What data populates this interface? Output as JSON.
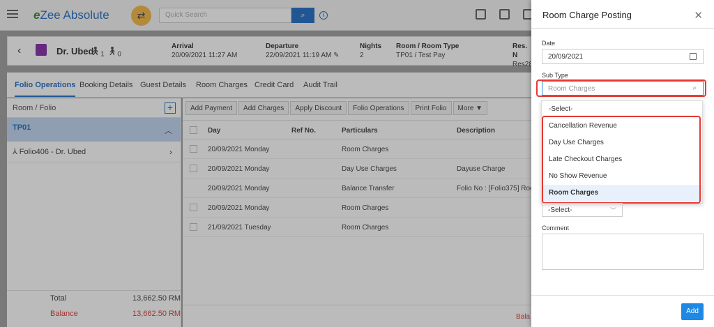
{
  "topbar": {
    "logo_e": "e",
    "logo_text": "Zee Absolute",
    "search_placeholder": "Quick Search",
    "search_icon": "search-icon",
    "info_icon": "info-icon"
  },
  "guest": {
    "back_icon": "back-arrow-icon",
    "name": "Dr. Ubed",
    "pax": "1 0",
    "arrival_label": "Arrival",
    "arrival_value": "20/09/2021 11:27 AM",
    "departure_label": "Departure",
    "departure_value": "22/09/2021 11:19 AM",
    "nights_label": "Nights",
    "nights_value": "2",
    "room_label": "Room / Room Type",
    "room_value": "TP01 / Test Pay",
    "res_label": "Res. N",
    "res_value": "Res28"
  },
  "tabs": [
    {
      "label": "Folio Operations"
    },
    {
      "label": "Booking Details"
    },
    {
      "label": "Guest Details"
    },
    {
      "label": "Room Charges"
    },
    {
      "label": "Credit Card"
    },
    {
      "label": "Audit Trail"
    }
  ],
  "left": {
    "header": "Room / Folio",
    "room": "TP01",
    "folio": "Folio406 - Dr. Ubed",
    "total_label": "Total",
    "total_value": "13,662.50 RM",
    "balance_label": "Balance",
    "balance_value": "13,662.50 RM"
  },
  "toolbar": {
    "add_payment": "Add Payment",
    "add_charges": "Add Charges",
    "apply_discount": "Apply Discount",
    "folio_operations": "Folio Operations",
    "print_folio": "Print Folio",
    "more": "More"
  },
  "table": {
    "headers": {
      "day": "Day",
      "ref": "Ref No.",
      "particulars": "Particulars",
      "description": "Description"
    },
    "rows": [
      {
        "day": "20/09/2021 Monday",
        "particulars": "Room Charges",
        "description": ""
      },
      {
        "day": "20/09/2021 Monday",
        "particulars": "Day Use Charges",
        "description": "Dayuse Charge"
      },
      {
        "day": "20/09/2021 Monday",
        "particulars": "Balance Transfer",
        "description": "Folio No : [Folio375] Roo"
      },
      {
        "day": "20/09/2021 Monday",
        "particulars": "Room Charges",
        "description": ""
      },
      {
        "day": "21/09/2021 Tuesday",
        "particulars": "Room Charges",
        "description": ""
      }
    ],
    "footer_bala": "Bala"
  },
  "drawer": {
    "title": "Room Charge Posting",
    "date_label": "Date",
    "date_value": "20/09/2021",
    "subtype_label": "Sub Type",
    "subtype_placeholder": "Room Charges",
    "options": [
      "-Select-",
      "Cancellation Revenue",
      "Day Use Charges",
      "Late Checkout Charges",
      "No Show Revenue",
      "Room Charges"
    ],
    "second_select": "-Select-",
    "comment_label": "Comment",
    "add_label": "Add"
  },
  "colors": {
    "accent": "#1565c0",
    "highlight": "#e53935",
    "selected_row": "#bcd3ee",
    "balance": "#d32f2f"
  }
}
